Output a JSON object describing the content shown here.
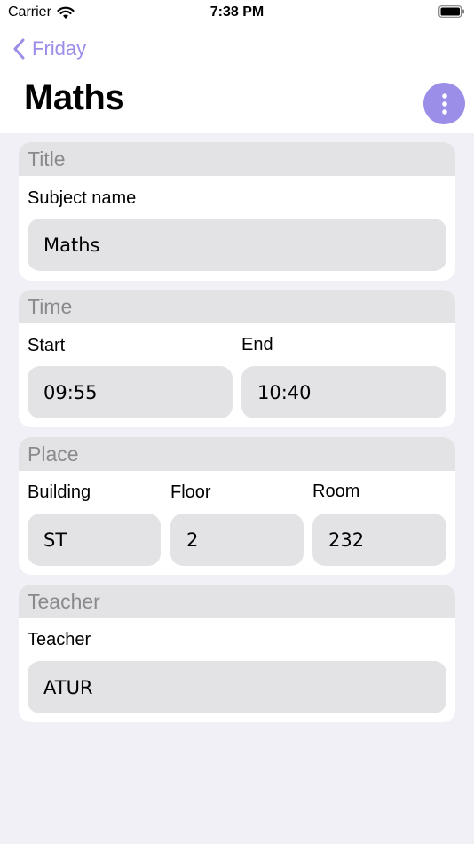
{
  "status_bar": {
    "carrier": "Carrier",
    "time": "7:38 PM"
  },
  "nav": {
    "back_label": "Friday",
    "title": "Maths"
  },
  "sections": {
    "title": {
      "header": "Title",
      "subject_label": "Subject name",
      "subject_value": "Maths"
    },
    "time": {
      "header": "Time",
      "start_label": "Start",
      "start_value": "09:55",
      "end_label": "End",
      "end_value": "10:40"
    },
    "place": {
      "header": "Place",
      "building_label": "Building",
      "building_value": "ST",
      "floor_label": "Floor",
      "floor_value": "2",
      "room_label": "Room",
      "room_value": "232"
    },
    "teacher": {
      "header": "Teacher",
      "teacher_label": "Teacher",
      "teacher_value": "ATUR"
    }
  },
  "colors": {
    "accent": "#9a8ee8",
    "background": "#f1f0f6",
    "field": "#e3e3e6",
    "header_text": "#8a8a8e"
  },
  "icons": {
    "back": "chevron-left-icon",
    "more": "ellipsis-vertical-icon",
    "wifi": "wifi-icon",
    "battery": "battery-icon"
  }
}
